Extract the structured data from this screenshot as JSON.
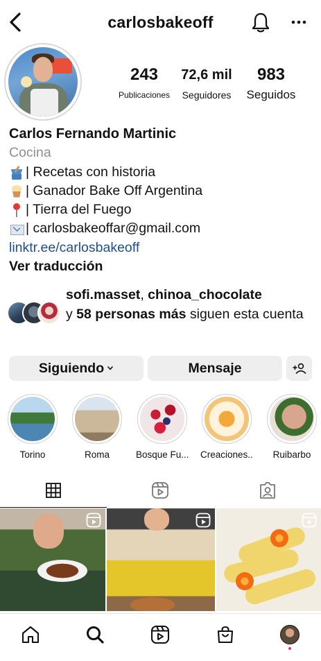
{
  "header": {
    "username": "carlosbakeoff",
    "back_icon": "chevron-left-icon",
    "notifications_icon": "bell-icon",
    "more_icon": "more-horizontal-icon"
  },
  "stats": {
    "posts_count": "243",
    "posts_label": "Publicaciones",
    "followers_count": "72,6 mil",
    "followers_label": "Seguidores",
    "following_count": "983",
    "following_label": "Seguidos"
  },
  "bio": {
    "name": "Carlos Fernando Martinic",
    "category": "Cocina",
    "lines": [
      {
        "icon": "mixing-bowl-icon",
        "text": "| Recetas con historia"
      },
      {
        "icon": "cupcake-icon",
        "text": "| Ganador Bake Off Argentina"
      },
      {
        "icon": "pin-icon",
        "text": "| Tierra del Fuego"
      },
      {
        "icon": "envelope-icon",
        "text": "| carlosbakeoffar@gmail.com"
      }
    ],
    "link": "linktr.ee/carlosbakeoff",
    "translate": "Ver traducción"
  },
  "mutual": {
    "user1": "sofi.masset",
    "separator": ", ",
    "user2": "chinoa_chocolate",
    "and": "y ",
    "others": "58 personas más",
    "suffix": " siguen esta cuenta"
  },
  "actions": {
    "follow_label": "Siguiendo",
    "message_label": "Mensaje",
    "suggest_icon": "add-person-icon"
  },
  "highlights": [
    {
      "label": "Torino"
    },
    {
      "label": "Roma"
    },
    {
      "label": "Bosque Fu..."
    },
    {
      "label": "Creaciones..."
    },
    {
      "label": "Ruibarbo"
    }
  ],
  "tabs": {
    "grid_icon": "grid-icon",
    "reels_icon": "reels-icon",
    "tagged_icon": "tagged-icon",
    "active": "grid"
  },
  "nav": {
    "home_icon": "home-icon",
    "search_icon": "search-icon",
    "reels_icon": "reels-icon",
    "shop_icon": "shop-icon",
    "profile_icon": "profile-avatar"
  },
  "colors": {
    "link": "#1d4f8c",
    "button_bg": "#eeeeee",
    "notification_dot": "#e1306c"
  }
}
